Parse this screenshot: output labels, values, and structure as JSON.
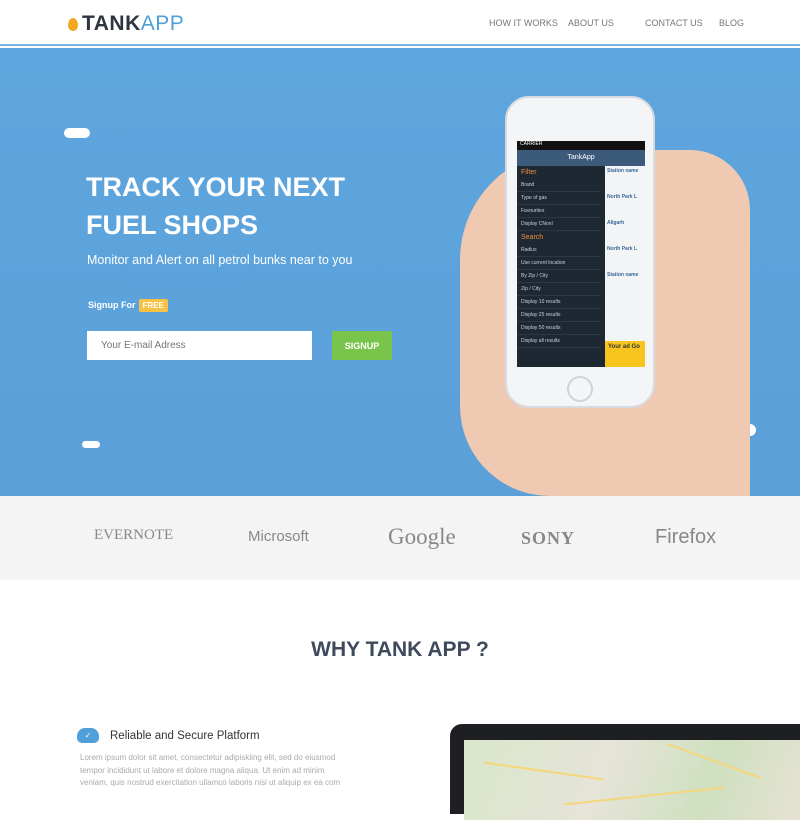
{
  "nav": {
    "logo_main": "TANK",
    "logo_accent": "APP",
    "links": [
      "HOW IT WORKS",
      "ABOUT US",
      "CONTACT US",
      "BLOG"
    ]
  },
  "hero": {
    "title": "TRACK YOUR NEXT FUEL SHOPS",
    "subtitle": "Monitor and Alert on all petrol bunks near to you",
    "signup_label": "Signup For",
    "signup_badge": "FREE",
    "email_placeholder": "Your E-mail Adress",
    "button": "SIGNUP"
  },
  "phone": {
    "carrier": "CARRIER",
    "app_title": "TankApp",
    "filter": "Filter",
    "filter_rows": [
      "Brand",
      "Type of gas",
      "Favourites",
      "Display CNonl"
    ],
    "search": "Search",
    "search_rows": [
      "Radius",
      "Use current location",
      "By Zip / City",
      "Zip / City",
      "Display 10 results",
      "Display 25 results",
      "Display 50 results",
      "Display all results"
    ],
    "list": [
      "Station name",
      "North Park L",
      "Aligarh",
      "North Park L",
      "Station name"
    ],
    "ad": "Your ad Go"
  },
  "partners": [
    "EVERNOTE",
    "Microsoft",
    "Google",
    "SONY",
    "Firefox"
  ],
  "why": {
    "title": "WHY TANK APP ?",
    "feature_title": "Reliable and Secure Platform",
    "feature_text": "Lorem ipsum dolor sit amet, consectetur adipiskiing elit, sed do eiusmod tempor incididunt ut labore et dolore magna aliqua. Ut enim ad minim veniam, quis nostrud exercitation ullamco laboris nisi ut aliquip ex ea com"
  }
}
